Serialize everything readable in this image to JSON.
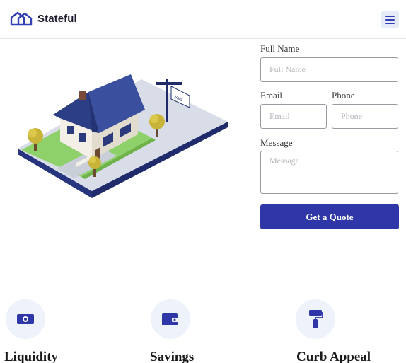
{
  "header": {
    "brand_name": "Stateful",
    "brand_icon": "house-outline-icon",
    "menu_icon": "hamburger-menu-icon"
  },
  "hero": {
    "illustration": "isometric-house-with-for-sale-sign",
    "sign_text": "Sold"
  },
  "form": {
    "full_name_label": "Full Name",
    "full_name_placeholder": "Full Name",
    "email_label": "Email",
    "email_placeholder": "Email",
    "phone_label": "Phone",
    "phone_placeholder": "Phone",
    "message_label": "Message",
    "message_placeholder": "Message",
    "submit_label": "Get a Quote"
  },
  "features": [
    {
      "title": "Liquidity",
      "icon": "cash-icon"
    },
    {
      "title": "Savings",
      "icon": "wallet-icon"
    },
    {
      "title": "Curb Appeal",
      "icon": "paint-roller-icon"
    }
  ],
  "colors": {
    "accent": "#2e36a8",
    "icon_bg": "#eef2fa",
    "menu_bg": "#e6ecf7"
  }
}
